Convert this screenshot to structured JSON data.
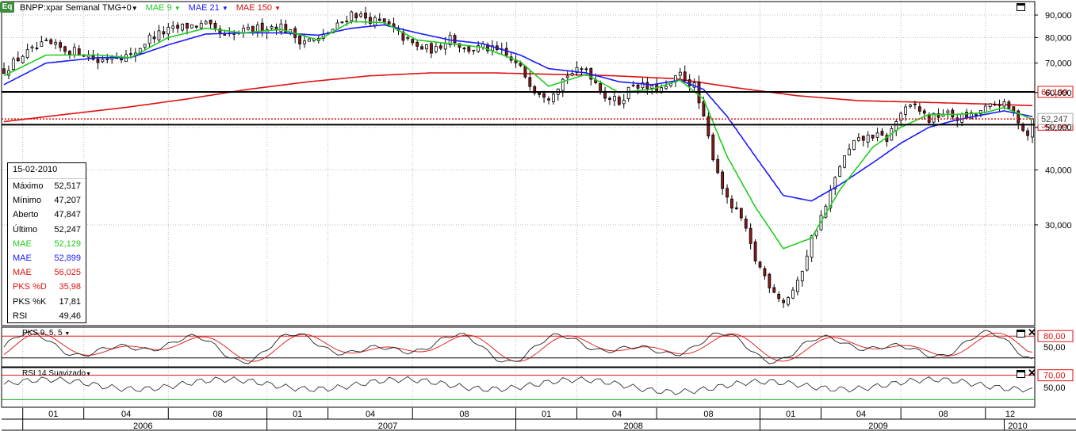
{
  "header": {
    "logo": "Eq",
    "symbol": "BNPP:xpar Semanal TMG+0",
    "indicators": [
      {
        "label": "MAE 9",
        "color": "#22cc22"
      },
      {
        "label": "MAE 21",
        "color": "#1a1aff"
      },
      {
        "label": "MAE 150",
        "color": "#dd1111"
      }
    ]
  },
  "legend": {
    "date": "15-02-2010",
    "rows": [
      {
        "label": "Máximo",
        "value": "52,517",
        "color": "#000000"
      },
      {
        "label": "Mínimo",
        "value": "47,207",
        "color": "#000000"
      },
      {
        "label": "Aberto",
        "value": "47,847",
        "color": "#000000"
      },
      {
        "label": "Último",
        "value": "52,247",
        "color": "#000000"
      },
      {
        "label": "MAE",
        "value": "52,129",
        "color": "#22cc22"
      },
      {
        "label": "MAE",
        "value": "52,899",
        "color": "#1a1aff"
      },
      {
        "label": "MAE",
        "value": "56,025",
        "color": "#dd1111"
      },
      {
        "label": "PKS %D",
        "value": "35,98",
        "color": "#dd1111"
      },
      {
        "label": "PKS %K",
        "value": "17,81",
        "color": "#000000"
      },
      {
        "label": "RSI",
        "value": "49,46",
        "color": "#000000"
      }
    ]
  },
  "panels": {
    "pks_title": "PKS 9, 5, 5",
    "rsi_title": "RSI 14 Suavizado"
  },
  "chart_data": [
    {
      "type": "candlestick",
      "panel": "price",
      "y_scale": "log",
      "ylim": [
        18000,
        95000
      ],
      "y_ticks": [
        "90,000",
        "80,000",
        "70,000",
        "60,000",
        "50,000",
        "40,000",
        "30,000"
      ],
      "y_tick_values": [
        90000,
        80000,
        70000,
        60000,
        50000,
        40000,
        30000
      ],
      "horizontal_lines": [
        {
          "value": 60199,
          "label": "60,199",
          "style": "solid",
          "color": "#000000"
        },
        {
          "value": 50709,
          "label": "50,709",
          "style": "solid",
          "color": "#000000"
        },
        {
          "value": 52247,
          "label": "52,247",
          "style": "dotted",
          "color": "#dd1111"
        }
      ],
      "x_start": "2005-12-05",
      "x_end": "2010-02-15",
      "x_month_labels": [
        {
          "date": "2006-01-02",
          "label": "01"
        },
        {
          "date": "2006-04-03",
          "label": "04"
        },
        {
          "date": "2006-08-07",
          "label": "08"
        },
        {
          "date": "2007-01-01",
          "label": "01"
        },
        {
          "date": "2007-04-02",
          "label": "04"
        },
        {
          "date": "2007-08-06",
          "label": "08"
        },
        {
          "date": "2008-01-07",
          "label": "01"
        },
        {
          "date": "2008-04-07",
          "label": "04"
        },
        {
          "date": "2008-08-04",
          "label": "08"
        },
        {
          "date": "2009-01-05",
          "label": "01"
        },
        {
          "date": "2009-04-06",
          "label": "04"
        },
        {
          "date": "2009-08-03",
          "label": "08"
        },
        {
          "date": "2009-12-07",
          "label": "12"
        }
      ],
      "x_year_labels": [
        {
          "date": "2006-07-01",
          "label": "2006"
        },
        {
          "date": "2007-07-01",
          "label": "2007"
        },
        {
          "date": "2008-07-01",
          "label": "2008"
        },
        {
          "date": "2009-07-01",
          "label": "2009"
        },
        {
          "date": "2010-01-25",
          "label": "2010"
        }
      ],
      "close_path": [
        [
          "2005-12-05",
          67500
        ],
        [
          "2006-01-02",
          73000
        ],
        [
          "2006-02-06",
          77500
        ],
        [
          "2006-03-06",
          75000
        ],
        [
          "2006-04-03",
          74000
        ],
        [
          "2006-04-24",
          70500
        ],
        [
          "2006-05-15",
          73000
        ],
        [
          "2006-06-12",
          72500
        ],
        [
          "2006-07-10",
          80000
        ],
        [
          "2006-08-07",
          83000
        ],
        [
          "2006-09-04",
          85000
        ],
        [
          "2006-10-02",
          85500
        ],
        [
          "2006-10-30",
          80000
        ],
        [
          "2006-11-27",
          82500
        ],
        [
          "2006-12-25",
          84500
        ],
        [
          "2007-01-22",
          85000
        ],
        [
          "2007-02-19",
          79000
        ],
        [
          "2007-03-19",
          79000
        ],
        [
          "2007-04-16",
          85000
        ],
        [
          "2007-05-07",
          91000
        ],
        [
          "2007-06-04",
          88000
        ],
        [
          "2007-07-02",
          85000
        ],
        [
          "2007-07-23",
          80000
        ],
        [
          "2007-08-13",
          76000
        ],
        [
          "2007-09-10",
          75000
        ],
        [
          "2007-10-01",
          81000
        ],
        [
          "2007-10-22",
          75000
        ],
        [
          "2007-11-19",
          76000
        ],
        [
          "2007-12-17",
          74000
        ],
        [
          "2008-01-14",
          68000
        ],
        [
          "2008-02-04",
          61000
        ],
        [
          "2008-02-25",
          59000
        ],
        [
          "2008-03-24",
          66000
        ],
        [
          "2008-04-21",
          68000
        ],
        [
          "2008-05-19",
          59000
        ],
        [
          "2008-06-09",
          57000
        ],
        [
          "2008-06-30",
          63000
        ],
        [
          "2008-07-28",
          61000
        ],
        [
          "2008-08-18",
          61000
        ],
        [
          "2008-09-08",
          66000
        ],
        [
          "2008-09-29",
          62000
        ],
        [
          "2008-10-13",
          52000
        ],
        [
          "2008-10-27",
          43000
        ],
        [
          "2008-11-17",
          34000
        ],
        [
          "2008-12-08",
          31000
        ],
        [
          "2008-12-29",
          25000
        ],
        [
          "2009-01-19",
          22000
        ],
        [
          "2009-02-09",
          20000
        ],
        [
          "2009-03-02",
          22000
        ],
        [
          "2009-03-23",
          28000
        ],
        [
          "2009-04-13",
          33000
        ],
        [
          "2009-05-04",
          41000
        ],
        [
          "2009-05-25",
          46000
        ],
        [
          "2009-06-22",
          48000
        ],
        [
          "2009-07-13",
          47000
        ],
        [
          "2009-08-03",
          54000
        ],
        [
          "2009-08-24",
          56000
        ],
        [
          "2009-09-14",
          52000
        ],
        [
          "2009-10-05",
          54000
        ],
        [
          "2009-10-26",
          52500
        ],
        [
          "2009-11-16",
          53000
        ],
        [
          "2009-12-07",
          55000
        ],
        [
          "2009-12-28",
          57000
        ],
        [
          "2010-01-18",
          54000
        ],
        [
          "2010-02-08",
          48000
        ],
        [
          "2010-02-15",
          52247
        ]
      ],
      "mae9_path": [
        [
          "2005-12-05",
          65500
        ],
        [
          "2006-02-06",
          73000
        ],
        [
          "2006-04-24",
          73000
        ],
        [
          "2006-06-12",
          72000
        ],
        [
          "2006-08-07",
          80000
        ],
        [
          "2006-10-02",
          84000
        ],
        [
          "2006-11-27",
          82000
        ],
        [
          "2007-01-22",
          83500
        ],
        [
          "2007-03-19",
          79000
        ],
        [
          "2007-05-07",
          87000
        ],
        [
          "2007-06-25",
          86500
        ],
        [
          "2007-08-13",
          79000
        ],
        [
          "2007-10-01",
          77500
        ],
        [
          "2007-11-19",
          76000
        ],
        [
          "2008-01-14",
          70500
        ],
        [
          "2008-02-25",
          62000
        ],
        [
          "2008-04-21",
          66000
        ],
        [
          "2008-06-09",
          60000
        ],
        [
          "2008-07-28",
          61000
        ],
        [
          "2008-09-08",
          64000
        ],
        [
          "2008-10-13",
          58000
        ],
        [
          "2008-11-17",
          43000
        ],
        [
          "2008-12-29",
          33000
        ],
        [
          "2009-02-09",
          26500
        ],
        [
          "2009-03-23",
          28000
        ],
        [
          "2009-05-04",
          36000
        ],
        [
          "2009-06-22",
          45000
        ],
        [
          "2009-08-03",
          50000
        ],
        [
          "2009-09-14",
          53500
        ],
        [
          "2009-10-26",
          53500
        ],
        [
          "2009-12-07",
          54000
        ],
        [
          "2010-01-04",
          55500
        ],
        [
          "2010-02-15",
          52129
        ]
      ],
      "mae21_path": [
        [
          "2005-12-05",
          62500
        ],
        [
          "2006-02-06",
          70000
        ],
        [
          "2006-04-24",
          72000
        ],
        [
          "2006-06-12",
          72000
        ],
        [
          "2006-08-07",
          77000
        ],
        [
          "2006-10-02",
          81500
        ],
        [
          "2006-11-27",
          82000
        ],
        [
          "2007-01-22",
          82000
        ],
        [
          "2007-03-19",
          81000
        ],
        [
          "2007-05-07",
          84000
        ],
        [
          "2007-06-25",
          85500
        ],
        [
          "2007-08-13",
          82000
        ],
        [
          "2007-10-01",
          79000
        ],
        [
          "2007-11-19",
          77500
        ],
        [
          "2008-01-14",
          73000
        ],
        [
          "2008-02-25",
          68000
        ],
        [
          "2008-04-21",
          66500
        ],
        [
          "2008-06-09",
          63500
        ],
        [
          "2008-07-28",
          62500
        ],
        [
          "2008-09-08",
          64000
        ],
        [
          "2008-10-13",
          61000
        ],
        [
          "2008-11-17",
          53000
        ],
        [
          "2008-12-29",
          43000
        ],
        [
          "2009-02-09",
          35000
        ],
        [
          "2009-03-23",
          34000
        ],
        [
          "2009-05-04",
          37000
        ],
        [
          "2009-06-22",
          41500
        ],
        [
          "2009-08-03",
          46000
        ],
        [
          "2009-09-14",
          50000
        ],
        [
          "2009-10-26",
          52000
        ],
        [
          "2009-12-07",
          53500
        ],
        [
          "2010-01-04",
          54500
        ],
        [
          "2010-02-15",
          52899
        ]
      ],
      "mae150_path": [
        [
          "2005-12-05",
          51500
        ],
        [
          "2006-03-06",
          53500
        ],
        [
          "2006-06-05",
          55500
        ],
        [
          "2006-09-04",
          58000
        ],
        [
          "2006-12-04",
          61000
        ],
        [
          "2007-03-05",
          63500
        ],
        [
          "2007-06-04",
          65500
        ],
        [
          "2007-09-03",
          66500
        ],
        [
          "2007-12-03",
          66500
        ],
        [
          "2008-03-03",
          66000
        ],
        [
          "2008-06-02",
          65500
        ],
        [
          "2008-09-01",
          64500
        ],
        [
          "2008-12-01",
          61500
        ],
        [
          "2009-03-02",
          59000
        ],
        [
          "2009-06-01",
          57500
        ],
        [
          "2009-09-07",
          57000
        ],
        [
          "2009-12-07",
          56500
        ],
        [
          "2010-02-15",
          56025
        ]
      ]
    },
    {
      "type": "line",
      "panel": "stochastic",
      "name": "PKS 9, 5, 5",
      "ylim": [
        0,
        100
      ],
      "y_ticks": [
        "80,00",
        "50,00"
      ],
      "y_tick_values": [
        80,
        50
      ],
      "level_line": 80,
      "last_k": 17.81,
      "last_d": 35.98
    },
    {
      "type": "line",
      "panel": "rsi",
      "name": "RSI 14 Suavizado",
      "ylim": [
        20,
        80
      ],
      "y_ticks": [
        "70,00",
        "50,00"
      ],
      "y_tick_values": [
        70,
        50
      ],
      "level_line": 70,
      "last_value": 49.46
    }
  ]
}
